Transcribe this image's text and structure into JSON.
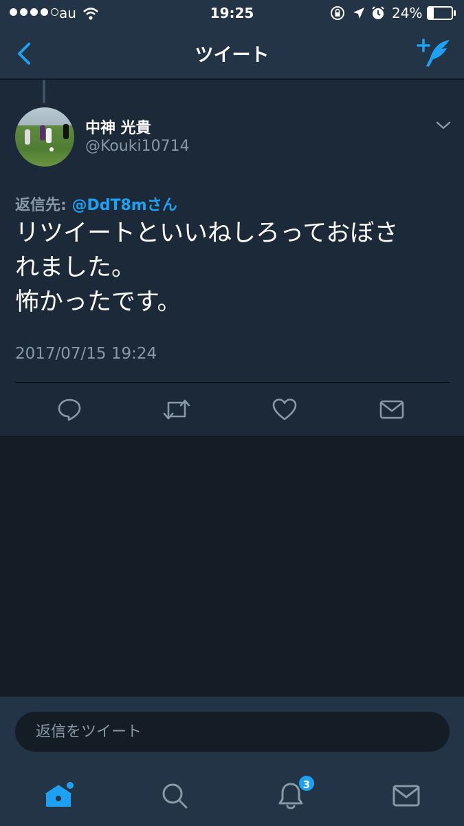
{
  "status_bar": {
    "carrier": "au",
    "time": "19:25",
    "battery": "24%",
    "battery_level": 0.24,
    "signal_bars": 4
  },
  "nav": {
    "title": "ツイート",
    "back_icon": "chevron-left-icon",
    "compose_icon": "compose-tweet-icon"
  },
  "tweet": {
    "author_name": "中神 光貴",
    "author_handle": "@Kouki10714",
    "reply_label": "返信先:",
    "reply_mention": "@DdT8mさん",
    "text": "リツイートといいねしろっておぼさ\nれました。\n怖かったです。",
    "timestamp": "2017/07/15 19:24"
  },
  "reply": {
    "placeholder": "返信をツイート"
  },
  "tabs": {
    "notification_count": "3"
  },
  "colors": {
    "accent": "#1da1f2",
    "panel": "#1c2938",
    "bar": "#243447",
    "background": "#141d26",
    "muted": "#8899a6"
  }
}
